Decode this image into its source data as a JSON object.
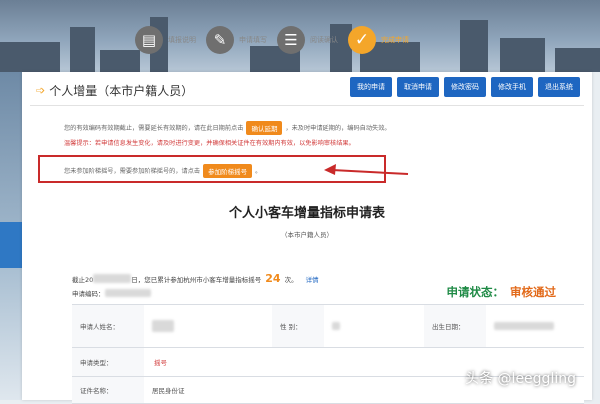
{
  "steps": [
    {
      "label": "填报说明",
      "icon": "document-icon",
      "glyph": "▤",
      "state": "done"
    },
    {
      "label": "申请填写",
      "icon": "edit-icon",
      "glyph": "✎",
      "state": "done"
    },
    {
      "label": "阅读确认",
      "icon": "chat-icon",
      "glyph": "☰",
      "state": "done"
    },
    {
      "label": "完成申请",
      "icon": "check-icon",
      "glyph": "✓",
      "state": "active"
    }
  ],
  "page": {
    "title": "个人增量（本市户籍人员）"
  },
  "actions": [
    "我的申请",
    "取消申请",
    "修改密码",
    "修改手机",
    "退出系统"
  ],
  "notice": {
    "line1_prefix": "您的有效编码有效期截止，需要延长有效期的，请在此日期前点击",
    "line1_button": "确认延期",
    "line1_suffix": "，未及时申请延期的，编码自动失效。",
    "line2": "温馨提示：若申请信息发生变化，请及时进行变更，并确保相关证件在有效期内有效，以免影响审核结果。",
    "line3_prefix": "您未参加阶梯摇号，需要参加阶梯摇号的，请点击",
    "line3_button": "参加阶梯摇号",
    "line3_suffix": "。"
  },
  "form": {
    "title": "个人小客车增量指标申请表",
    "subtitle": "（本市户籍人员）",
    "stat_prefix": "截止20",
    "stat_middle": "日，您已累计参加杭州市小客车增量指标摇号",
    "stat_count": "24",
    "stat_unit": "次。",
    "stat_link": "详情",
    "app_no_label": "申请编码：",
    "status_label": "申请状态：",
    "status_value": "审核通过",
    "fields": {
      "name_label": "申请人姓名：",
      "gender_label": "性 别：",
      "birth_label": "出生日期：",
      "type_label": "申请类型：",
      "type_value": "摇号",
      "id_label": "证件名称：",
      "id_value": "居民身份证"
    }
  },
  "watermark": "头条 @leeggling",
  "colors": {
    "accent": "#f08a1c",
    "primary": "#1e66c1",
    "success": "#1e8a45",
    "alert": "#c92a2a"
  }
}
